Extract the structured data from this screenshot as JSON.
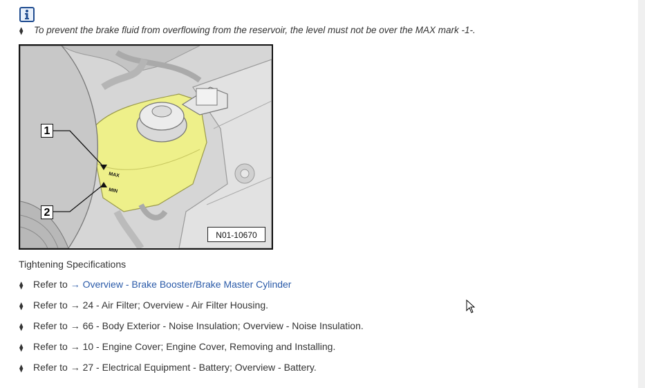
{
  "note": {
    "bullet": "⧫",
    "text": "To prevent the brake fluid from overflowing from the reservoir, the level must not be over the MAX mark -1-."
  },
  "figure": {
    "code": "N01-10670",
    "callouts": [
      "1",
      "2"
    ],
    "max_mark": "MAX",
    "min_mark": "MIN"
  },
  "specs": {
    "heading": "Tightening Specifications",
    "items": [
      {
        "prefix": "Refer to ",
        "link": "→ Overview - Brake Booster/Brake Master Cylinder",
        "rest": ""
      },
      {
        "prefix": "Refer to ",
        "link": "",
        "rest": "→ 24 - Air Filter; Overview - Air Filter Housing."
      },
      {
        "prefix": "Refer to ",
        "link": "",
        "rest": "→ 66 - Body Exterior - Noise Insulation; Overview - Noise Insulation."
      },
      {
        "prefix": "Refer to ",
        "link": "",
        "rest": "→ 10 - Engine Cover; Engine Cover, Removing and Installing."
      },
      {
        "prefix": "Refer to ",
        "link": "",
        "rest": "→ 27 - Electrical Equipment - Battery; Overview - Battery."
      }
    ]
  },
  "bullet_glyph": "⧫",
  "colors": {
    "link": "#2a5aa8",
    "text": "#333333",
    "info_icon": "#1e4b8f",
    "highlight": "#eef08a"
  }
}
